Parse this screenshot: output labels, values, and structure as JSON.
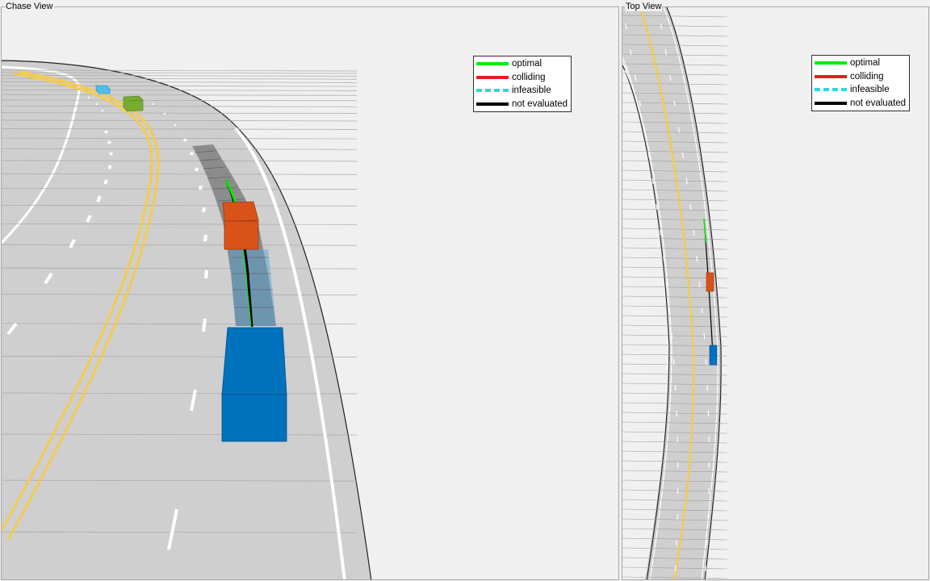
{
  "panels": {
    "chase": {
      "title": "Chase View"
    },
    "top": {
      "title": "Top View"
    }
  },
  "legend": {
    "items": [
      {
        "label": "optimal",
        "color": "#00ee00",
        "style": "solid"
      },
      {
        "label": "colliding",
        "color": "#e02020",
        "style": "solid"
      },
      {
        "label": "infeasible",
        "color": "#22dddd",
        "style": "dashed"
      },
      {
        "label": "not evaluated",
        "color": "#000000",
        "style": "solid"
      }
    ]
  },
  "colors": {
    "background": "#f0f0f0",
    "road": "#cfcfcf",
    "lane_marking": "#ffffff",
    "center_line": "#f2cc50",
    "ego_vehicle": "#0072bd",
    "lead_vehicle": "#d95319",
    "vehicle_green": "#77ac30",
    "vehicle_cyan": "#4dbeee",
    "trajectory_optimal": "#00ee00"
  }
}
